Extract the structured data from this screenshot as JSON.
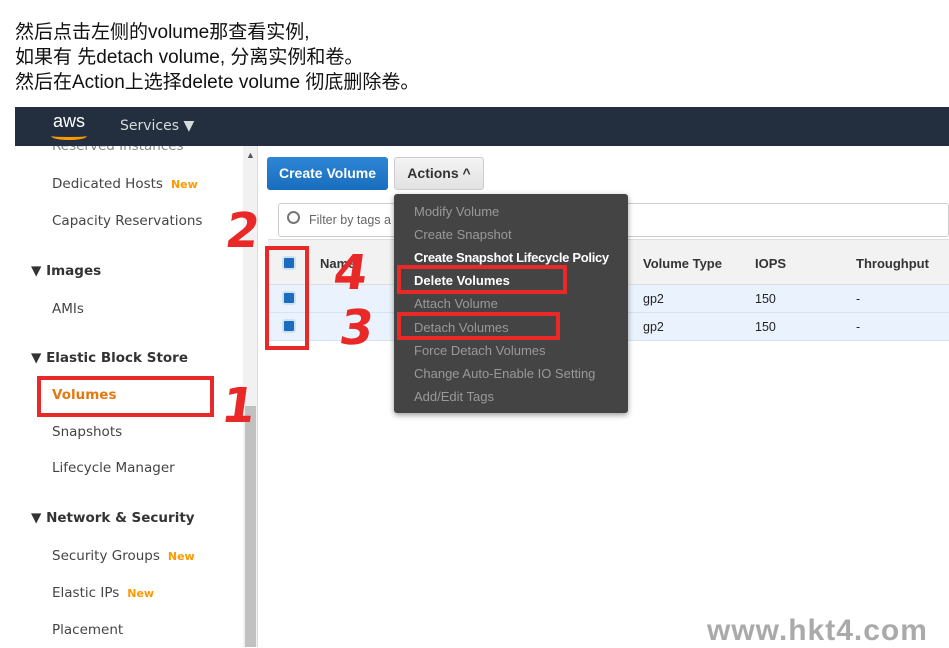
{
  "notes": [
    "然后点击左侧的volume那查看实例,",
    "如果有 先detach volume, 分离实例和卷。",
    "然后在Action上选择delete volume 彻底删除卷。"
  ],
  "nav": {
    "logo": "aws",
    "services": "Services ▼"
  },
  "sidebar": {
    "cut_item": "Reserved Instances",
    "items": [
      {
        "label": "Dedicated Hosts",
        "badge": "New"
      },
      {
        "label": "Capacity Reservations"
      },
      {
        "label": "▼  Images",
        "header": true
      },
      {
        "label": "AMIs"
      },
      {
        "label": "▼  Elastic Block Store",
        "header": true
      },
      {
        "label": "Volumes",
        "active": true
      },
      {
        "label": "Snapshots"
      },
      {
        "label": "Lifecycle Manager"
      },
      {
        "label": "▼  Network & Security",
        "header": true
      },
      {
        "label": "Security Groups",
        "badge": "New"
      },
      {
        "label": "Elastic IPs",
        "badge": "New"
      },
      {
        "label": "Placement"
      }
    ]
  },
  "toolbar": {
    "create": "Create Volume",
    "actions": "Actions ^"
  },
  "filter": {
    "placeholder": "Filter by tags a"
  },
  "table": {
    "headers": [
      "Name",
      "Volume Type",
      "IOPS",
      "Throughput"
    ],
    "rows": [
      {
        "type": "gp2",
        "iops": "150",
        "throughput": "-"
      },
      {
        "type": "gp2",
        "iops": "150",
        "throughput": "-"
      }
    ]
  },
  "menu": [
    {
      "label": "Modify Volume",
      "enabled": false
    },
    {
      "label": "Create Snapshot",
      "enabled": false
    },
    {
      "label": "Create Snapshot Lifecycle Policy",
      "enabled": true
    },
    {
      "label": "Delete Volumes",
      "enabled": true
    },
    {
      "label": "Attach Volume",
      "enabled": false
    },
    {
      "label": "Detach Volumes",
      "enabled": false
    },
    {
      "label": "Force Detach Volumes",
      "enabled": false
    },
    {
      "label": "Change Auto-Enable IO Setting",
      "enabled": false
    },
    {
      "label": "Add/Edit Tags",
      "enabled": false
    }
  ],
  "annotations": [
    "1",
    "2",
    "3",
    "4"
  ],
  "watermark": "www.hkt4.com",
  "colors": {
    "accent": "#1a6dbd",
    "active": "#f90",
    "annotation": "#e92828",
    "nav": "#232f3e"
  }
}
